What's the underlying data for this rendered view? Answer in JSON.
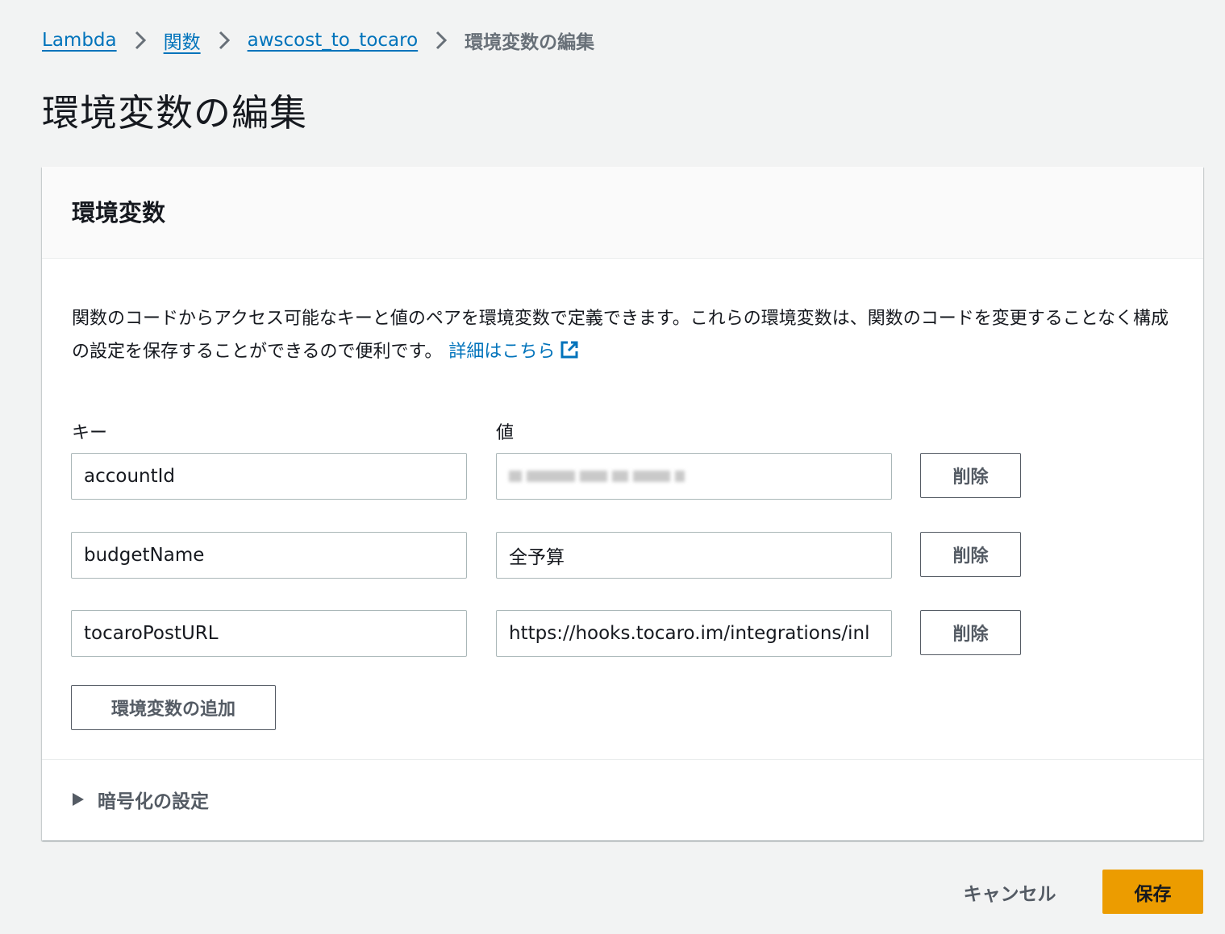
{
  "breadcrumb": {
    "items": [
      "Lambda",
      "関数",
      "awscost_to_tocaro"
    ],
    "current": "環境変数の編集"
  },
  "page_title": "環境変数の編集",
  "panel": {
    "title": "環境変数",
    "description": "関数のコードからアクセス可能なキーと値のペアを環境変数で定義できます。これらの環境変数は、関数のコードを変更することなく構成の設定を保存することができるので便利です。",
    "learn_more": "詳細はこちら",
    "key_label": "キー",
    "value_label": "値",
    "variables": [
      {
        "key": "accountId",
        "value": ""
      },
      {
        "key": "budgetName",
        "value": "全予算"
      },
      {
        "key": "tocaroPostURL",
        "value": "https://hooks.tocaro.im/integrations/inl"
      }
    ],
    "remove_label": "削除",
    "add_label": "環境変数の追加",
    "encryption_label": "暗号化の設定"
  },
  "footer": {
    "cancel_label": "キャンセル",
    "save_label": "保存"
  },
  "colors": {
    "link": "#0073bb",
    "primary_button": "#ec9c00",
    "background": "#f2f3f3"
  },
  "icons": [
    "chevron-right-icon",
    "external-link-icon",
    "caret-right-icon"
  ]
}
